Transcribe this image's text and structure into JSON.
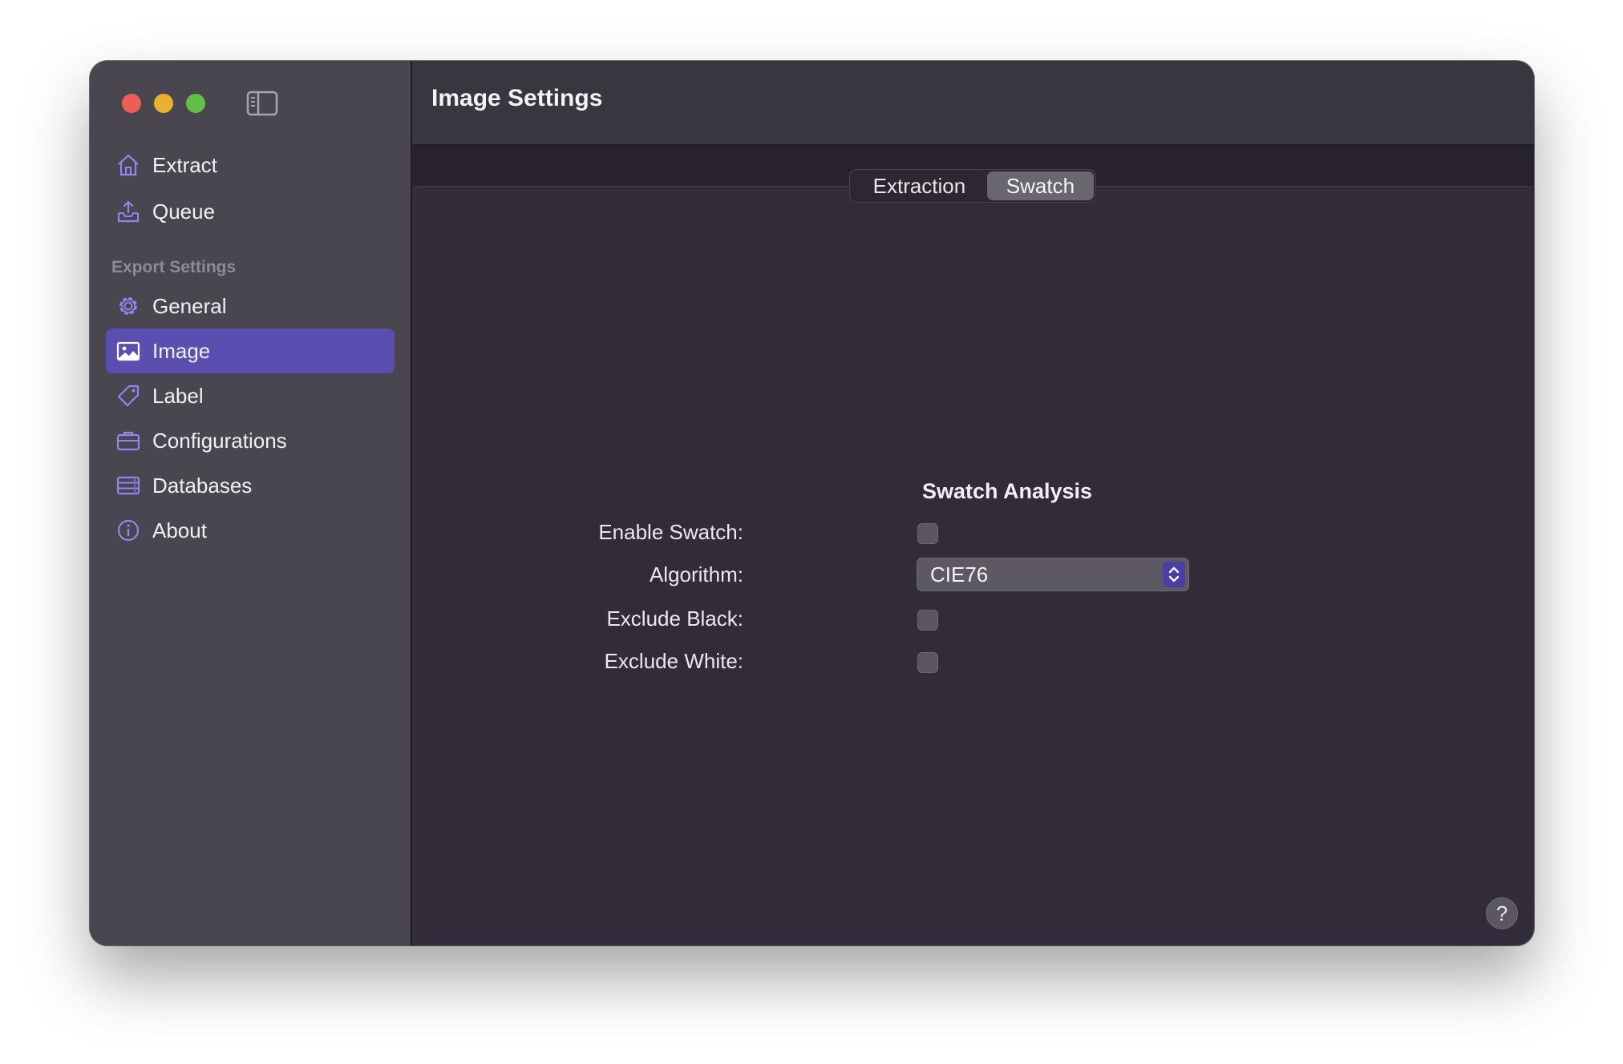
{
  "sidebar": {
    "items_top": [
      {
        "label": "Extract",
        "icon": "house-icon"
      },
      {
        "label": "Queue",
        "icon": "tray-upload-icon"
      }
    ],
    "section_label": "Export Settings",
    "items": [
      {
        "label": "General",
        "icon": "gear-icon"
      },
      {
        "label": "Image",
        "icon": "photo-icon",
        "selected": true
      },
      {
        "label": "Label",
        "icon": "tag-icon"
      },
      {
        "label": "Configurations",
        "icon": "briefcase-icon"
      },
      {
        "label": "Databases",
        "icon": "server-rack-icon"
      },
      {
        "label": "About",
        "icon": "info-icon"
      }
    ]
  },
  "header": {
    "title": "Image Settings"
  },
  "tabs": [
    {
      "label": "Extraction",
      "selected": false
    },
    {
      "label": "Swatch",
      "selected": true
    }
  ],
  "form": {
    "title": "Swatch Analysis",
    "enable_swatch": {
      "label": "Enable Swatch:",
      "checked": false
    },
    "algorithm": {
      "label": "Algorithm:",
      "value": "CIE76"
    },
    "exclude_black": {
      "label": "Exclude Black:",
      "checked": false
    },
    "exclude_white": {
      "label": "Exclude White:",
      "checked": false
    }
  },
  "help": {
    "label": "?"
  },
  "colors": {
    "accent": "#5a4fb0",
    "icon_tint": "#8f86f0",
    "sidebar_bg": "#4a4650",
    "content_bg": "#322b39"
  }
}
